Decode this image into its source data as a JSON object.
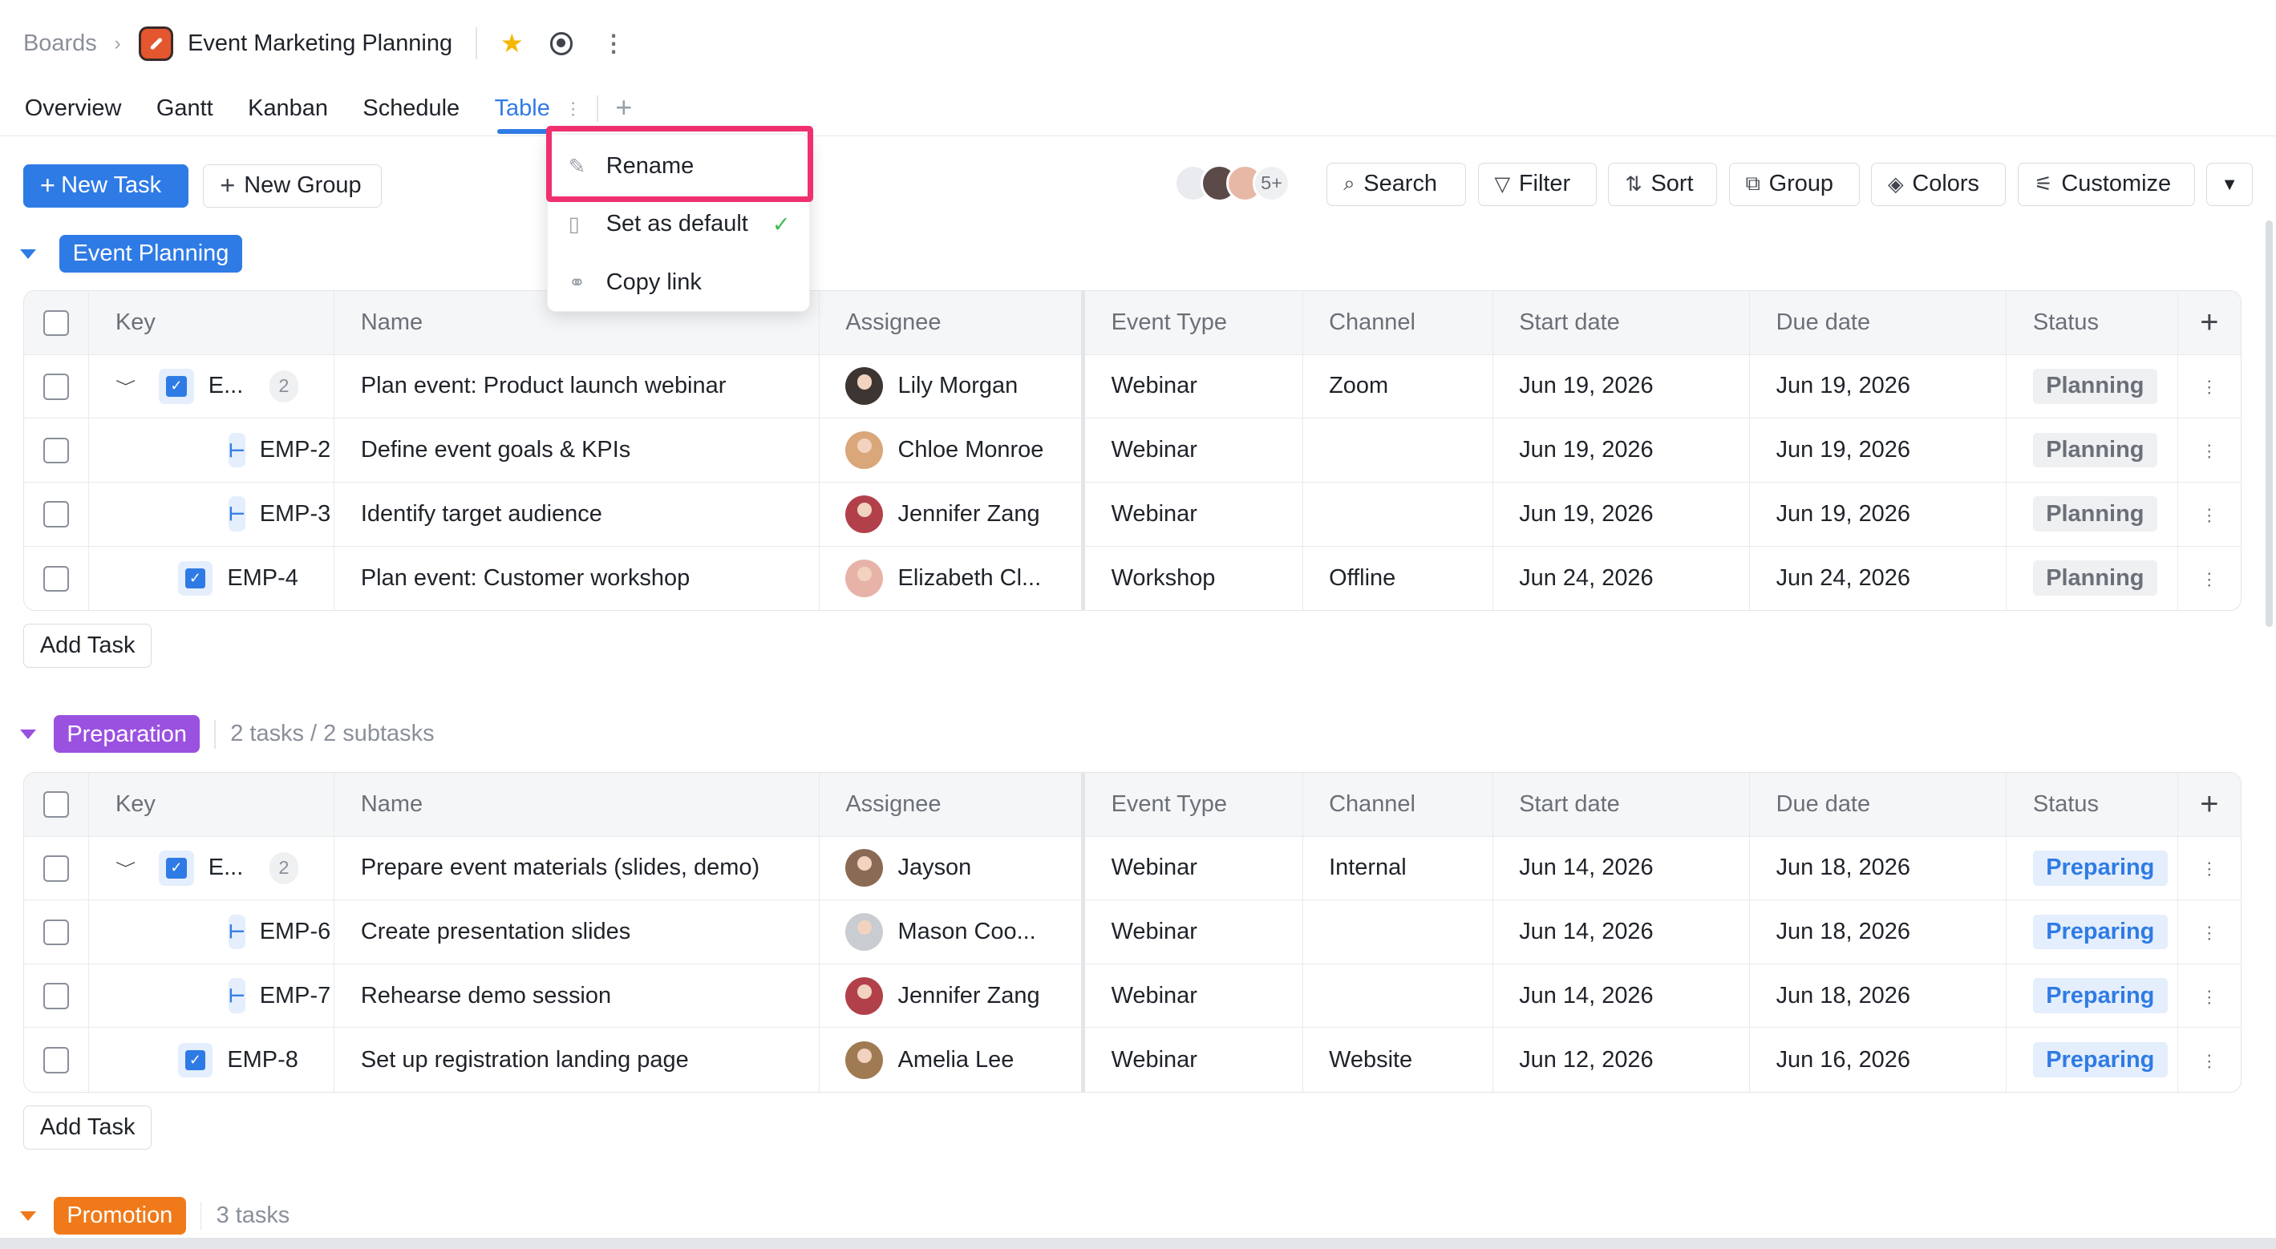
{
  "breadcrumb": {
    "root": "Boards",
    "board_title": "Event Marketing Planning"
  },
  "tabs": [
    {
      "label": "Overview"
    },
    {
      "label": "Gantt"
    },
    {
      "label": "Kanban"
    },
    {
      "label": "Schedule"
    },
    {
      "label": "Table"
    }
  ],
  "toolbar": {
    "new_task": "New Task",
    "new_group": "New Group",
    "more_members": "5+",
    "search": "Search",
    "filter": "Filter",
    "sort": "Sort",
    "group": "Group",
    "colors": "Colors",
    "customize": "Customize"
  },
  "menu": {
    "rename": "Rename",
    "set_default": "Set as default",
    "copy_link": "Copy link"
  },
  "columns": [
    "Key",
    "Name",
    "Assignee",
    "Event Type",
    "Channel",
    "Start date",
    "Due date",
    "Status"
  ],
  "add_task": "Add Task",
  "groups": [
    {
      "name": "Event Planning",
      "color": "#2f7be5",
      "summary": "",
      "rows": [
        {
          "key": "E...",
          "subcount": "2",
          "name": "Plan event: Product launch webinar",
          "assignee": "Lily Morgan",
          "event_type": "Webinar",
          "channel": "Zoom",
          "start": "Jun 19, 2026",
          "due": "Jun 19, 2026",
          "status": "Planning"
        },
        {
          "key": "EMP-2",
          "name": "Define event goals & KPIs",
          "assignee": "Chloe Monroe",
          "event_type": "Webinar",
          "channel": "",
          "start": "Jun 19, 2026",
          "due": "Jun 19, 2026",
          "status": "Planning"
        },
        {
          "key": "EMP-3",
          "name": "Identify target audience",
          "assignee": "Jennifer Zang",
          "event_type": "Webinar",
          "channel": "",
          "start": "Jun 19, 2026",
          "due": "Jun 19, 2026",
          "status": "Planning"
        },
        {
          "key": "EMP-4",
          "name": "Plan event: Customer workshop",
          "assignee": "Elizabeth Cl...",
          "event_type": "Workshop",
          "channel": "Offline",
          "start": "Jun 24, 2026",
          "due": "Jun 24, 2026",
          "status": "Planning"
        }
      ]
    },
    {
      "name": "Preparation",
      "color": "#9b51e0",
      "summary": "2 tasks / 2 subtasks",
      "rows": [
        {
          "key": "E...",
          "subcount": "2",
          "name": "Prepare event materials (slides, demo)",
          "assignee": "Jayson",
          "event_type": "Webinar",
          "channel": "Internal",
          "start": "Jun 14, 2026",
          "due": "Jun 18, 2026",
          "status": "Preparing"
        },
        {
          "key": "EMP-6",
          "name": "Create presentation slides",
          "assignee": "Mason Coo...",
          "event_type": "Webinar",
          "channel": "",
          "start": "Jun 14, 2026",
          "due": "Jun 18, 2026",
          "status": "Preparing"
        },
        {
          "key": "EMP-7",
          "name": "Rehearse demo session",
          "assignee": "Jennifer Zang",
          "event_type": "Webinar",
          "channel": "",
          "start": "Jun 14, 2026",
          "due": "Jun 18, 2026",
          "status": "Preparing"
        },
        {
          "key": "EMP-8",
          "name": "Set up registration landing page",
          "assignee": "Amelia Lee",
          "event_type": "Webinar",
          "channel": "Website",
          "start": "Jun 12, 2026",
          "due": "Jun 16, 2026",
          "status": "Preparing"
        }
      ]
    },
    {
      "name": "Promotion",
      "color": "#f07a1a",
      "summary": "3 tasks"
    }
  ]
}
